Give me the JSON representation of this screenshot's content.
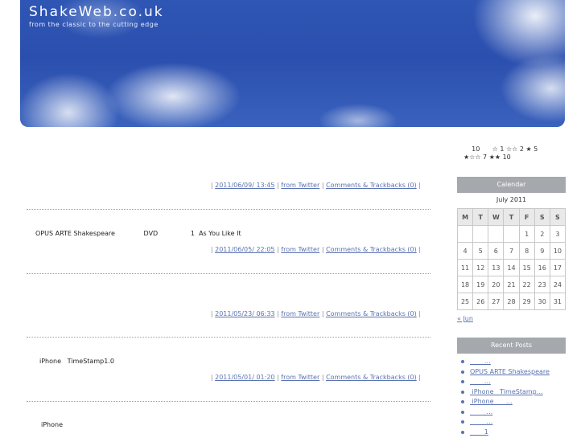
{
  "header": {
    "title": "ShakeWeb.co.uk",
    "tagline": "from the classic to the cutting edge"
  },
  "posts": [
    {
      "body": "",
      "date": "2011/06/09/ 13:45",
      "source": "from Twitter",
      "comments": "Comments & Trackbacks (0)"
    },
    {
      "body": "OPUS ARTE Shakespeare              DVD                1  As You Like It",
      "date": "2011/06/05/ 22:05",
      "source": "from Twitter",
      "comments": "Comments & Trackbacks (0)"
    },
    {
      "body": "",
      "date": "2011/05/23/ 06:33",
      "source": "from Twitter",
      "comments": "Comments & Trackbacks (0)"
    },
    {
      "body": "iPhone   TimeStamp1.0",
      "date": "2011/05/01/ 01:20",
      "source": "from Twitter",
      "comments": "Comments & Trackbacks (0)"
    },
    {
      "body": "iPhone",
      "date": "",
      "source": "",
      "comments": ""
    }
  ],
  "sidebar": {
    "stars_line1": "    10      ☆ 1 ☆☆ 2 ★ 5",
    "stars_line2": "★☆☆ 7 ★★ 10",
    "calendar": {
      "heading": "Calendar",
      "caption": "July 2011",
      "weekdays": [
        "M",
        "T",
        "W",
        "T",
        "F",
        "S",
        "S"
      ],
      "weeks": [
        [
          "",
          "",
          "",
          "",
          "1",
          "2",
          "3"
        ],
        [
          "4",
          "5",
          "6",
          "7",
          "8",
          "9",
          "10"
        ],
        [
          "11",
          "12",
          "13",
          "14",
          "15",
          "16",
          "17"
        ],
        [
          "18",
          "19",
          "20",
          "21",
          "22",
          "23",
          "24"
        ],
        [
          "25",
          "26",
          "27",
          "28",
          "29",
          "30",
          "31"
        ]
      ],
      "prev_link": "« Jun"
    },
    "recent": {
      "heading": "Recent Posts",
      "items": [
        "       …",
        "OPUS ARTE Shakespeare",
        "       …",
        " iPhone   TimeStamp…",
        " iPhone      …",
        "        …",
        "        …",
        "       1"
      ]
    }
  }
}
